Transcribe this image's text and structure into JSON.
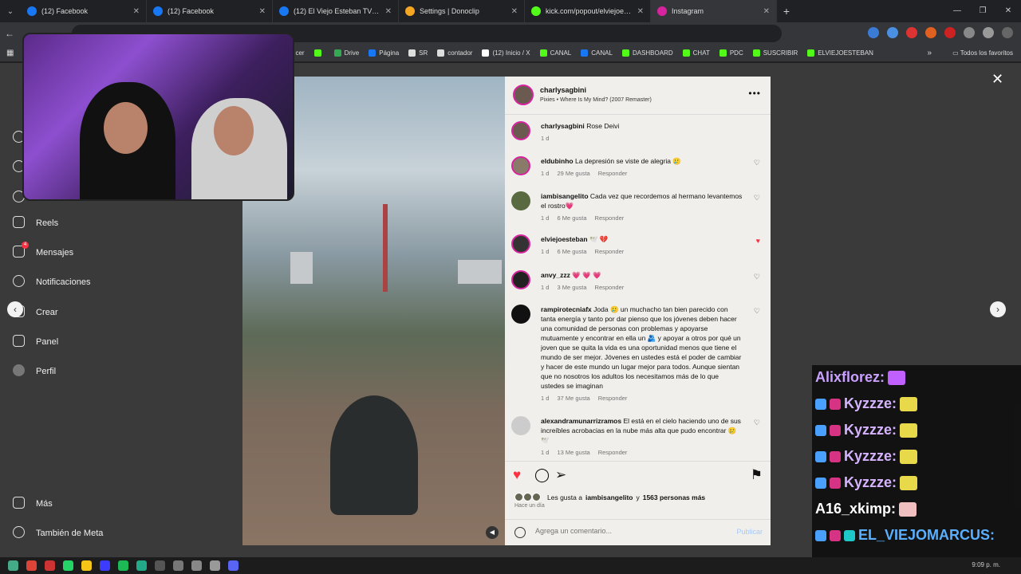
{
  "browser": {
    "tabs": [
      {
        "label": "(12) Facebook",
        "color": "#1877f2"
      },
      {
        "label": "(12) Facebook",
        "color": "#1877f2"
      },
      {
        "label": "(12) El Viejo Esteban TV Reels |",
        "color": "#1877f2"
      },
      {
        "label": "Settings | Donoclip",
        "color": "#f5a623"
      },
      {
        "label": "kick.com/popout/elviejoesteban",
        "color": "#53fc18"
      },
      {
        "label": "Instagram",
        "color": "#d6249f"
      }
    ],
    "bookmarks": [
      {
        "label": "cer",
        "color": "#888"
      },
      {
        "label": "",
        "color": "#53fc18"
      },
      {
        "label": "Drive",
        "color": "#34a853"
      },
      {
        "label": "Página",
        "color": "#1877f2"
      },
      {
        "label": "SR",
        "color": "#ddd"
      },
      {
        "label": "contador",
        "color": "#ddd"
      },
      {
        "label": "(12) Inicio / X",
        "color": "#fff"
      },
      {
        "label": "CANAL",
        "color": "#53fc18"
      },
      {
        "label": "CANAL",
        "color": "#1877f2"
      },
      {
        "label": "DASHBOARD",
        "color": "#53fc18"
      },
      {
        "label": "CHAT",
        "color": "#53fc18"
      },
      {
        "label": "PDC",
        "color": "#53fc18"
      },
      {
        "label": "SUSCRIBIR",
        "color": "#53fc18"
      },
      {
        "label": "ELVIEJOESTEBAN",
        "color": "#53fc18"
      }
    ],
    "favorites_label": "Todos los favoritos"
  },
  "sidebar": {
    "items": [
      {
        "label": "Reels"
      },
      {
        "label": "Mensajes",
        "badge": "4"
      },
      {
        "label": "Notificaciones"
      },
      {
        "label": "Crear"
      },
      {
        "label": "Panel"
      },
      {
        "label": "Perfil"
      },
      {
        "label": "Más"
      },
      {
        "label": "También de Meta"
      }
    ]
  },
  "post": {
    "username": "charlysagbini",
    "song": "Pixies • Where Is My Mind? (2007 Remaster)",
    "comments": [
      {
        "user": "charlysagbini",
        "text": "Rose Deivi",
        "age": "1 d",
        "likes": "",
        "reply": "",
        "liked": false,
        "avatar_color": "#6b5a50",
        "ring": true
      },
      {
        "user": "eldubinho",
        "text": "La depresión se viste de alegria 🥲",
        "age": "1 d",
        "likes": "29 Me gusta",
        "reply": "Responder",
        "liked": false,
        "avatar_color": "#8a7a6a",
        "ring": true
      },
      {
        "user": "iambisangelito",
        "text": "Cada vez que recordemos al hermano levantemos el rostro💗",
        "age": "1 d",
        "likes": "6 Me gusta",
        "reply": "Responder",
        "liked": false,
        "avatar_color": "#5a6a40",
        "ring": false
      },
      {
        "user": "elviejoesteban",
        "text": "🕊️ 💔",
        "age": "1 d",
        "likes": "6 Me gusta",
        "reply": "Responder",
        "liked": true,
        "avatar_color": "#333",
        "ring": true
      },
      {
        "user": "anvy_zzz",
        "text": "💗 💗 💗",
        "age": "1 d",
        "likes": "3 Me gusta",
        "reply": "Responder",
        "liked": false,
        "avatar_color": "#222",
        "ring": true
      },
      {
        "user": "rampirotecniafx",
        "text": "Joda 🥲 un muchacho tan bien parecido con tanta energía y tanto por dar pienso que los jóvenes deben hacer una comunidad de personas con problemas y apoyarse mutuamente y encontrar en ella un 🫂 y apoyar a otros por qué un joven que se quita la vida es una oportunidad menos que tiene el mundo de ser mejor. Jóvenes en ustedes está el poder de cambiar y hacer de este mundo un lugar mejor para todos. Aunque sientan que no nosotros los adultos los necesitamos más de lo que ustedes se imaginan",
        "age": "1 d",
        "likes": "37 Me gusta",
        "reply": "Responder",
        "liked": false,
        "avatar_color": "#111",
        "ring": false
      },
      {
        "user": "alexandramunarrizramos",
        "text": "El está en el cielo haciendo uno de sus increíbles acrobacias en la nube más alta que pudo encontrar 🥲 🕊️",
        "age": "1 d",
        "likes": "13 Me gusta",
        "reply": "Responder",
        "liked": false,
        "avatar_color": "#ccc",
        "ring": false
      }
    ],
    "likes_prefix": "Les gusta a",
    "likes_user": "iambisangelito",
    "likes_joiner": "y",
    "likes_others": "1563 personas más",
    "time_ago": "Hace un día",
    "comment_placeholder": "Agrega un comentario...",
    "publish_label": "Publicar"
  },
  "chat_overlay": {
    "lines": [
      {
        "user": "Alixflorez:",
        "color": "#c9a0ff",
        "badges": 0,
        "emote_color": "#c060ff"
      },
      {
        "user": "Kyzzze:",
        "color": "#d6b3ff",
        "badges": 2,
        "emote_color": "#e8d94a"
      },
      {
        "user": "Kyzzze:",
        "color": "#d6b3ff",
        "badges": 2,
        "emote_color": "#e8d94a"
      },
      {
        "user": "Kyzzze:",
        "color": "#d6b3ff",
        "badges": 2,
        "emote_color": "#e8d94a"
      },
      {
        "user": "Kyzzze:",
        "color": "#d6b3ff",
        "badges": 2,
        "emote_color": "#e8d94a"
      },
      {
        "user": "A16_xkimp:",
        "color": "#ffffff",
        "badges": 0,
        "emote_color": "#f0c0c0"
      },
      {
        "user": "EL_VIEJOMARCUS:",
        "color": "#5ab0ff",
        "badges": 3,
        "emote_color": ""
      }
    ]
  },
  "taskbar": {
    "clock": "9:09 p. m."
  }
}
